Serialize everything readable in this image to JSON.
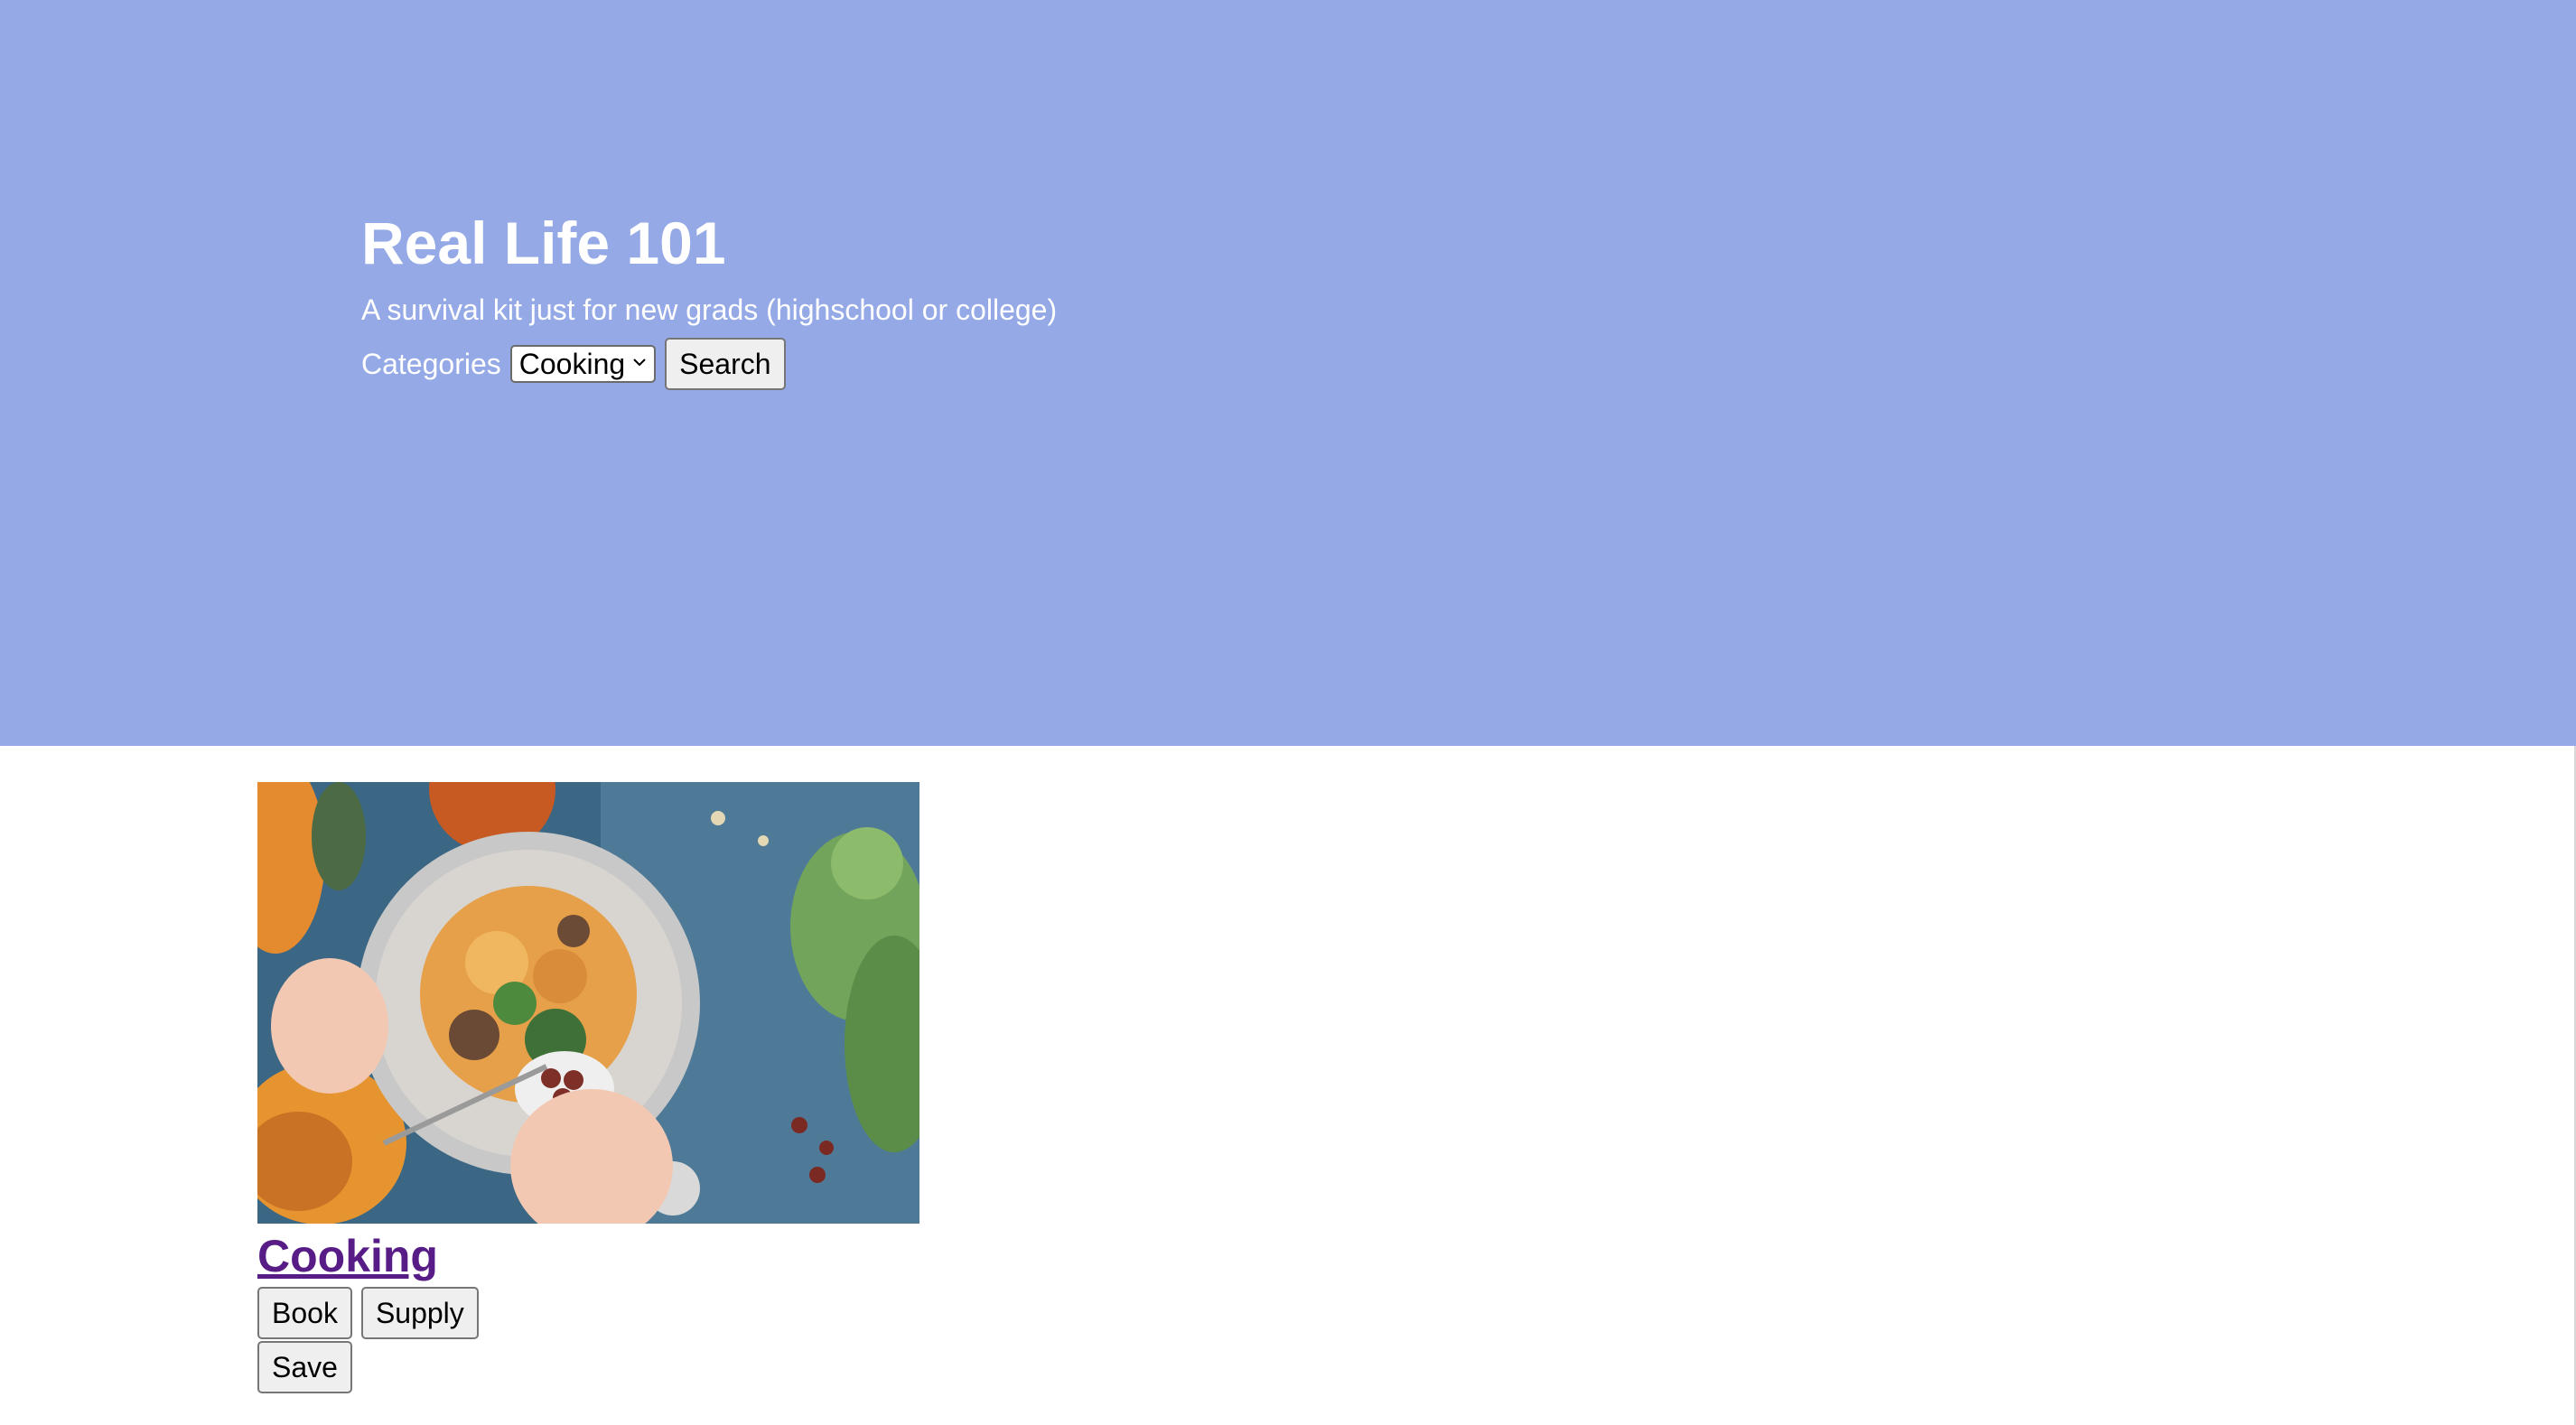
{
  "hero": {
    "title": "Real Life 101",
    "subtitle": "A survival kit just for new grads (highschool or college)",
    "categories_label": "Categories",
    "selected_category": "Cooking",
    "search_label": "Search",
    "background_color": "#94a9e6"
  },
  "card": {
    "image_icon": "food-bowl-photo",
    "title": "Cooking",
    "buttons": {
      "book": "Book",
      "supply": "Supply",
      "save": "Save"
    },
    "title_color": "#581c87"
  }
}
